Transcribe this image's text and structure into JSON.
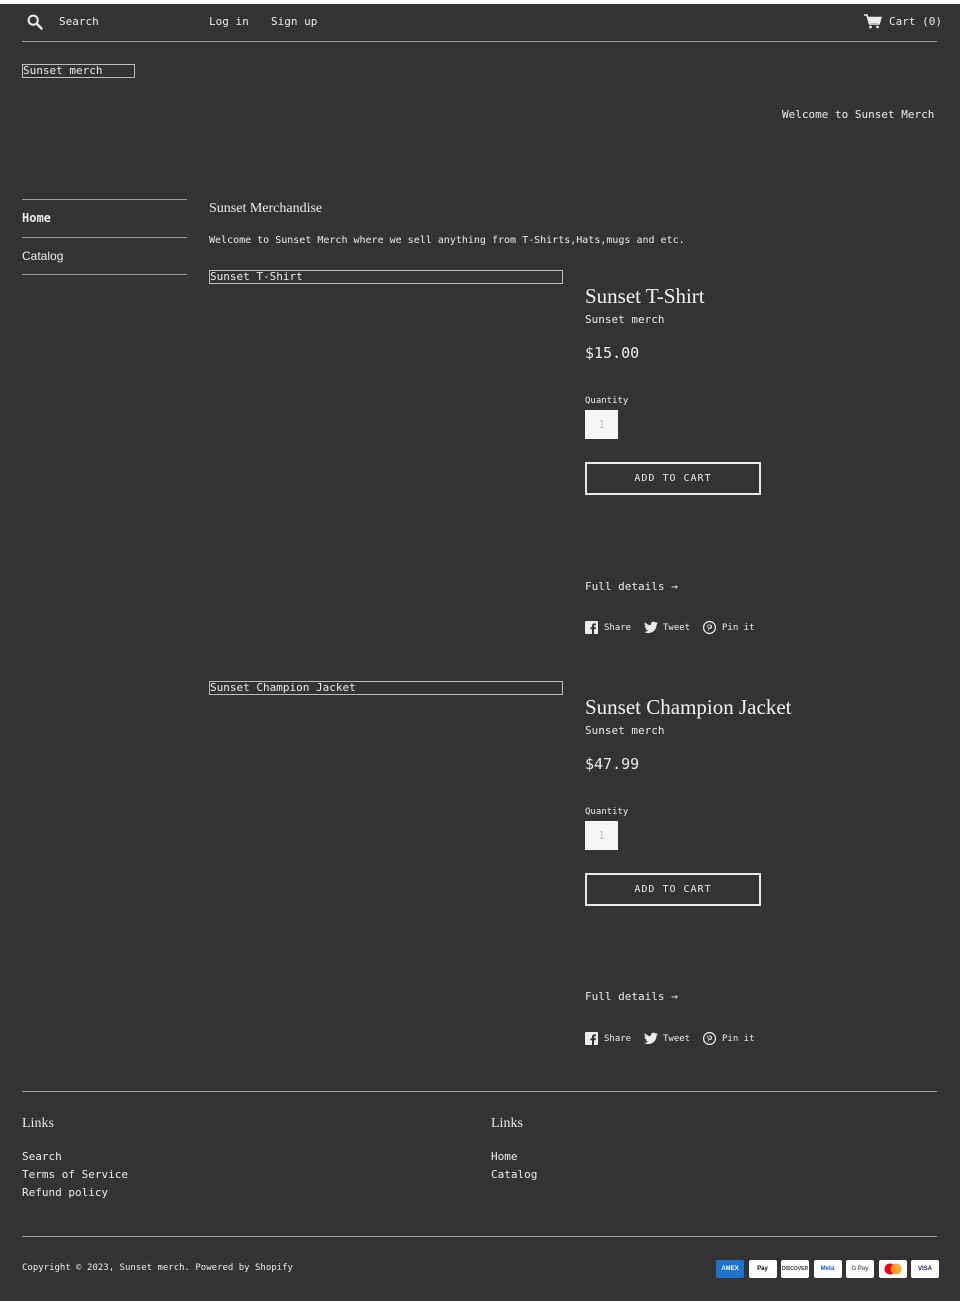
{
  "header": {
    "search_placeholder": "Search",
    "login": "Log in",
    "signup": "Sign up",
    "cart": "Cart (0)"
  },
  "logo": "Sunset merch",
  "welcome_banner": "Welcome to Sunset Merch",
  "sidebar": {
    "items": [
      {
        "label": "Home"
      },
      {
        "label": "Catalog"
      }
    ]
  },
  "main": {
    "title": "Sunset Merchandise",
    "intro": "Welcome to Sunset Merch where we sell anything from T-Shirts,Hats,mugs and etc."
  },
  "products": [
    {
      "image_alt": "Sunset T-Shirt",
      "title": "Sunset T-Shirt",
      "vendor": "Sunset merch",
      "price": "$15.00",
      "quantity_label": "Quantity",
      "quantity": "1",
      "add_to_cart": "ADD TO CART",
      "full_details": "Full details →",
      "share": "Share",
      "tweet": "Tweet",
      "pin": "Pin it"
    },
    {
      "image_alt": "Sunset Champion  Jacket",
      "title": "Sunset Champion Jacket",
      "vendor": "Sunset merch",
      "price": "$47.99",
      "quantity_label": "Quantity",
      "quantity": "1",
      "add_to_cart": "ADD TO CART",
      "full_details": "Full details →",
      "share": "Share",
      "tweet": "Tweet",
      "pin": "Pin it"
    }
  ],
  "footer": {
    "col1": {
      "heading": "Links",
      "links": [
        "Search",
        "Terms of Service",
        "Refund policy"
      ]
    },
    "col2": {
      "heading": "Links",
      "links": [
        "Home",
        "Catalog"
      ]
    },
    "copyright": "Copyright © 2023, Sunset merch. Powered by Shopify",
    "payments": [
      {
        "name": "amex-icon",
        "label": "AMEX",
        "bg": "#1f72cd",
        "fg": "#ffffff"
      },
      {
        "name": "apple-pay-icon",
        "label": "Pay",
        "bg": "#ffffff",
        "fg": "#000000"
      },
      {
        "name": "discover-icon",
        "label": "DISCOVER",
        "bg": "#ffffff",
        "fg": "#333333"
      },
      {
        "name": "meta-pay-icon",
        "label": "Meta",
        "bg": "#ffffff",
        "fg": "#1a5bd6"
      },
      {
        "name": "google-pay-icon",
        "label": "G Pay",
        "bg": "#ffffff",
        "fg": "#5f6368"
      },
      {
        "name": "mastercard-icon",
        "label": "",
        "bg": "#ffffff",
        "fg": "#000000"
      },
      {
        "name": "visa-icon",
        "label": "VISA",
        "bg": "#ffffff",
        "fg": "#1a1f71"
      }
    ]
  }
}
